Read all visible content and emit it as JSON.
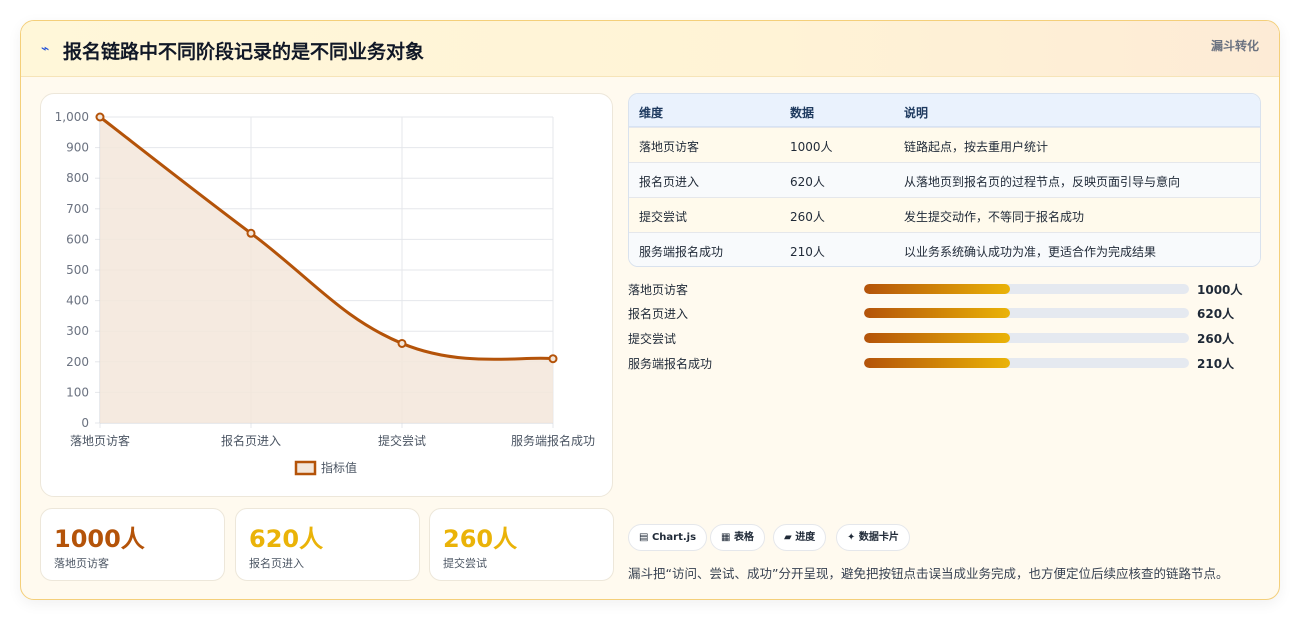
{
  "header": {
    "icon": "lightning-icon",
    "title": "报名链路中不同阶段记录的是不同业务对象",
    "tag": "漏斗转化"
  },
  "chart_data": {
    "type": "line",
    "categories": [
      "落地页访客",
      "报名页进入",
      "提交尝试",
      "服务端报名成功"
    ],
    "series": [
      {
        "name": "指标值",
        "values": [
          1000,
          620,
          260,
          210
        ]
      }
    ],
    "ylim": [
      0,
      1000
    ],
    "yticks": [
      0,
      100,
      200,
      300,
      400,
      500,
      600,
      700,
      800,
      900,
      1000
    ],
    "ytick_labels": [
      "0",
      "100",
      "200",
      "300",
      "400",
      "500",
      "600",
      "700",
      "800",
      "900",
      "1,000"
    ],
    "area_fill": true,
    "grid": true,
    "legend": "bottom",
    "colors": {
      "line": "#b45309",
      "fill": "#f3e6da"
    }
  },
  "stats": [
    {
      "value": "1000人",
      "label": "落地页访客",
      "color": "#b45309"
    },
    {
      "value": "620人",
      "label": "报名页进入",
      "color": "#eab308"
    },
    {
      "value": "260人",
      "label": "提交尝试",
      "color": "#eab308"
    }
  ],
  "table": {
    "headers": [
      "维度",
      "数据",
      "说明"
    ],
    "rows": [
      [
        "落地页访客",
        "1000人",
        "链路起点，按去重用户统计"
      ],
      [
        "报名页进入",
        "620人",
        "从落地页到报名页的过程节点，反映页面引导与意向"
      ],
      [
        "提交尝试",
        "260人",
        "发生提交动作，不等同于报名成功"
      ],
      [
        "服务端报名成功",
        "210人",
        "以业务系统确认成功为准，更适合作为完成结果"
      ]
    ]
  },
  "progress": [
    {
      "label": "落地页访客",
      "value": "1000人",
      "fraction": 0.45
    },
    {
      "label": "报名页进入",
      "value": "620人",
      "fraction": 0.45
    },
    {
      "label": "提交尝试",
      "value": "260人",
      "fraction": 0.45
    },
    {
      "label": "服务端报名成功",
      "value": "210人",
      "fraction": 0.45
    }
  ],
  "chips": [
    {
      "icon": "chart-icon",
      "glyph": "▤",
      "label": "Chart.js"
    },
    {
      "icon": "table-icon",
      "glyph": "▦",
      "label": "表格"
    },
    {
      "icon": "progress-icon",
      "glyph": "▰",
      "label": "进度"
    },
    {
      "icon": "sparkle-icon",
      "glyph": "✦",
      "label": "数据卡片"
    }
  ],
  "footnote": "漏斗把“访问、尝试、成功”分开呈现，避免把按钮点击误当成业务完成，也方便定位后续应核查的链路节点。"
}
